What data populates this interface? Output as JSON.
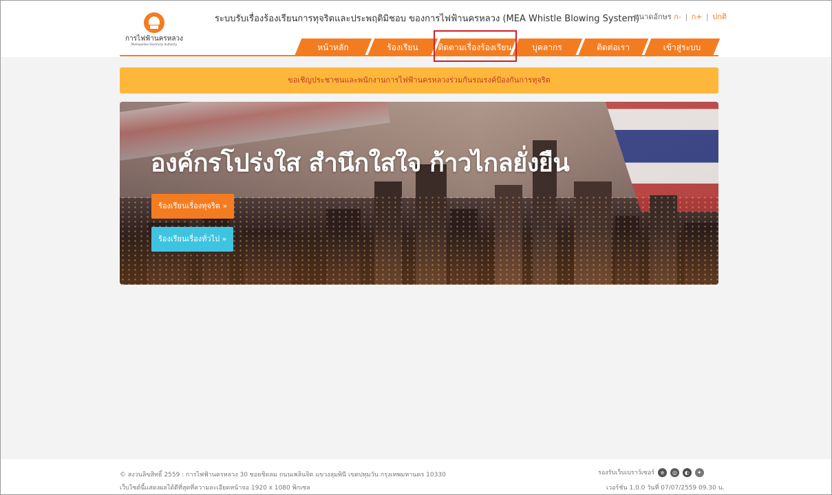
{
  "header": {
    "logo_name": "การไฟฟ้านครหลวง",
    "logo_sub": "Metropolitan Electricity Authority",
    "site_title": "ระบบรับเรื่องร้องเรียนการทุจริตและประพฤติมิชอบ ของการไฟฟ้านครหลวง (MEA Whistle Blowing System)",
    "font_size_label": "ขนาดอักษร",
    "font_decrease": "ก-",
    "font_increase": "ก+",
    "font_normal": "ปกติ",
    "separator": "|"
  },
  "nav": {
    "items": [
      {
        "label": "หน้าหลัก"
      },
      {
        "label": "ร้องเรียน"
      },
      {
        "label": "ติดตามเรื่องร้องเรียน"
      },
      {
        "label": "บุคลากร"
      },
      {
        "label": "ติดต่อเรา"
      },
      {
        "label": "เข้าสู่ระบบ"
      }
    ],
    "highlighted": "ติดตามเรื่องร้องเรียน"
  },
  "notice": {
    "text": "ขอเชิญประชาชนและพนักงานการไฟฟ้านครหลวงร่วมกันรณรงค์ป้องกันการทุจริต"
  },
  "banner": {
    "headline": "องค์กรโปร่งใส สำนึกใสใจ ก้าวไกลยั่งยืน",
    "btn_corruption": "ร้องเรียนเรื่องทุจริต »",
    "btn_general": "ร้องเรียนเรื่องทั่วไป »"
  },
  "footer": {
    "copyright": "© สงวนลิขสิทธิ์ 2559 : การไฟฟ้านครหลวง 30 ซอยชิดลม ถนนเพลินจิต แขวงลุมพินี เขตปทุมวัน กรุงเทพมหานคร 10330",
    "resolution": "เว็บไซต์นี้แสดงผลได้ดีที่สุดที่ความละเอียดหน้าจอ 1920 x 1080 พิกเซล",
    "browsers": "รองรับเว็บเบราว์เซอร์",
    "version": "เวอร์ชั่น 1.0.0 วันที่ 07/07/2559 09.30 น."
  },
  "colors": {
    "accent": "#f47c20",
    "notice_bg": "#ffb73b",
    "notice_text": "#c0392b",
    "button_general": "#3ec4e0",
    "highlight_box": "#d21f26"
  }
}
